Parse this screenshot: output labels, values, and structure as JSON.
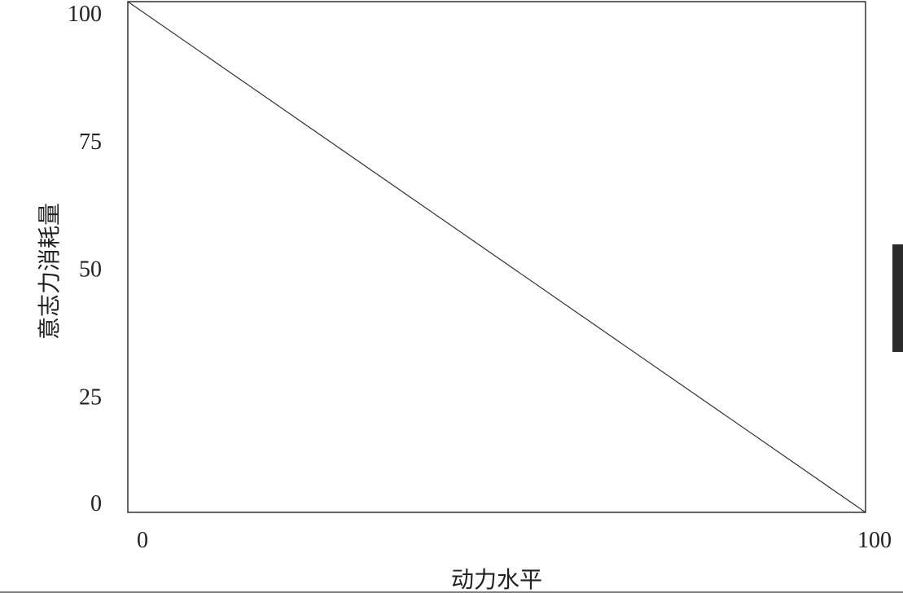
{
  "chart_data": {
    "type": "line",
    "title": "",
    "xlabel": "动力水平",
    "ylabel": "意志力消耗量",
    "xlim": [
      0,
      100
    ],
    "ylim": [
      0,
      100
    ],
    "x_ticks": [
      0,
      100
    ],
    "x_tick_labels": [
      "0",
      "100"
    ],
    "y_ticks": [
      0,
      25,
      50,
      75,
      100
    ],
    "y_tick_labels": [
      "0",
      "25",
      "50",
      "75",
      "100"
    ],
    "grid": false,
    "legend": "none",
    "series": [
      {
        "x": [
          0,
          100
        ],
        "y": [
          100,
          0
        ]
      }
    ]
  },
  "colors": {
    "line": "#333333",
    "text": "#222222",
    "side_marker": "#2b2b2b"
  }
}
